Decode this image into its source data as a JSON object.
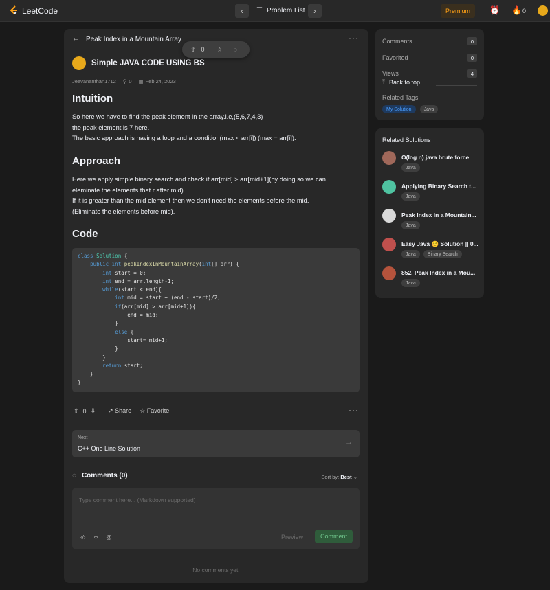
{
  "topbar": {
    "logo_text": "LeetCode",
    "problem_list": "Problem List",
    "premium": "Premium",
    "streak_count": "0"
  },
  "post": {
    "problem_title": "Peak Index in a Mountain Array",
    "toolbar_votes": "0",
    "title": "Simple JAVA CODE USING BS",
    "author": "Jeevananthan1712",
    "views_count": "0",
    "date": "Feb 24, 2023",
    "intuition_heading": "Intuition",
    "intuition_lines": [
      "So here we have to find the peak element in the array.i.e,(5,6,7,4,3)",
      "the peak element is 7 here.",
      "The basic approach is having a loop and a condition(max < arr[i]) (max = arr[i])."
    ],
    "approach_heading": "Approach",
    "approach_lines": [
      "Here we apply simple binary search and check if arr[mid] > arr[mid+1](by doing so we can",
      "eleminate the elements that r after mid).",
      "If it is greater than the mid element then we don't need the elements before the mid.",
      "(Eliminate the elements before mid)."
    ],
    "code_heading": "Code",
    "vote_count": "0",
    "share_label": "Share",
    "favorite_label": "Favorite",
    "next_label": "Next",
    "next_title": "C++ One Line Solution"
  },
  "comments": {
    "heading": "Comments (0)",
    "sort_label": "Sort by:",
    "sort_value": "Best",
    "placeholder": "Type comment here... (Markdown supported)",
    "preview_label": "Preview",
    "submit_label": "Comment",
    "empty_text": "No comments yet."
  },
  "stats": {
    "comments_label": "Comments",
    "comments_count": "0",
    "favorited_label": "Favorited",
    "favorited_count": "0",
    "views_label": "Views",
    "views_count": "4",
    "back_to_top": "Back to top",
    "related_tags_label": "Related Tags",
    "tags": [
      "My Solution",
      "Java"
    ]
  },
  "related": {
    "title": "Related Solutions",
    "items": [
      {
        "name": "O(log n) java brute force",
        "tags": [
          "Java"
        ],
        "avatar_color": "#a0685a"
      },
      {
        "name": "Applying Binary Search t...",
        "tags": [
          "Java"
        ],
        "avatar_color": "#4fc3a1"
      },
      {
        "name": "Peak Index in a Mountain...",
        "tags": [
          "Java"
        ],
        "avatar_color": "#d9d9d9"
      },
      {
        "name": "Easy Java 😊 Solution || 0...",
        "tags": [
          "Java",
          "Binary Search"
        ],
        "avatar_color": "#c0504d"
      },
      {
        "name": "852. Peak Index in a Mou...",
        "tags": [
          "Java"
        ],
        "avatar_color": "#b5533c"
      }
    ]
  }
}
